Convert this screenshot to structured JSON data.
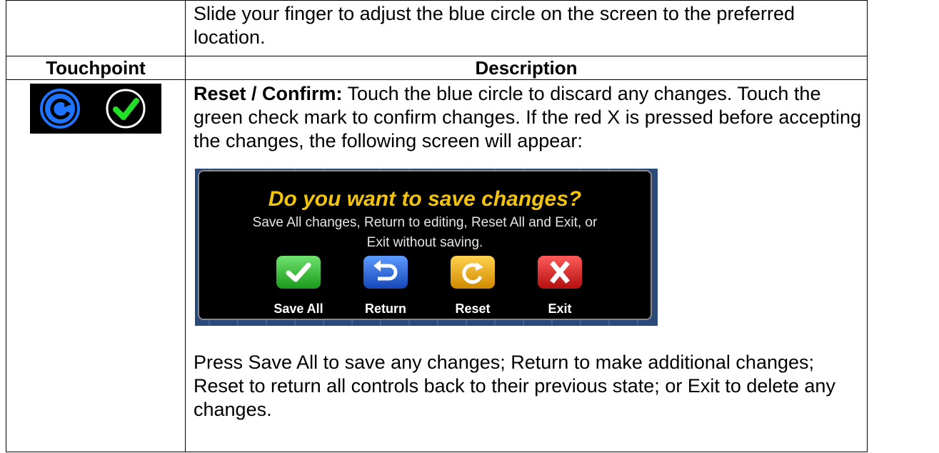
{
  "intro": {
    "text": "Slide your finger to adjust the blue circle on the screen to the preferred location."
  },
  "table": {
    "headers": [
      "Touchpoint",
      "Description"
    ]
  },
  "icons": {
    "reset": "reset-circle-icon",
    "confirm": "check-circle-icon"
  },
  "row": {
    "term": "Reset / Confirm:",
    "desc": "  Touch the blue circle to discard any changes.  Touch the green check mark to confirm changes.  If the red X is pressed before accepting the changes, the following screen will appear:",
    "after": "Press Save All to save any changes; Return to make additional changes; Reset to return all controls back to their previous state; or Exit to delete any changes."
  },
  "dialog": {
    "title": "Do you want to save changes?",
    "message": "Save All changes, Return to editing, Reset All and Exit, or Exit without saving.",
    "buttons": [
      {
        "label": "Save All",
        "icon": "check-icon",
        "color": "#2db82d"
      },
      {
        "label": "Return",
        "icon": "return-arrow-icon",
        "color": "#1f62d6"
      },
      {
        "label": "Reset",
        "icon": "reset-icon",
        "color": "#e8a800"
      },
      {
        "label": "Exit",
        "icon": "x-icon",
        "color": "#d91f1f"
      }
    ]
  },
  "colors": {
    "title_yellow": "#f2c40c",
    "icon_blue": "#1e74ff",
    "icon_green": "#22e02a"
  }
}
